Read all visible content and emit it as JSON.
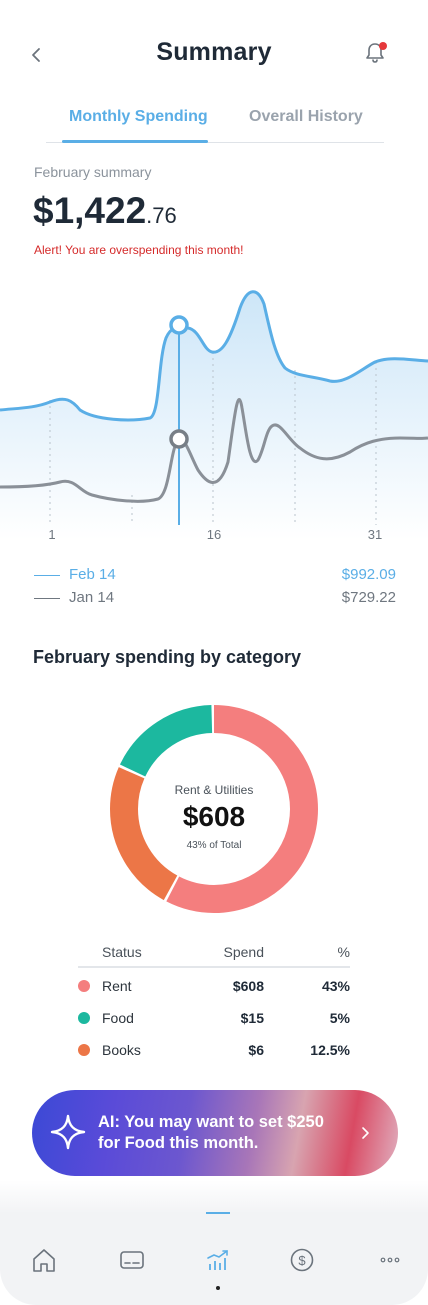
{
  "header": {
    "title": "Summary"
  },
  "tabs": [
    {
      "label": "Monthly Spending"
    },
    {
      "label": "Overall History"
    }
  ],
  "summary": {
    "label": "February summary",
    "total_main": "$1,422",
    "total_cents": ".76",
    "alert": "Alert! You are overspending this month!"
  },
  "chart_data": {
    "type": "area",
    "x_ticks": [
      "1",
      "16",
      "31"
    ],
    "series": [
      {
        "name": "Feb 14",
        "color": "#5aaee6"
      },
      {
        "name": "Jan 14",
        "color": "#8a9098"
      }
    ],
    "selected_x": "14"
  },
  "legend": [
    {
      "date": "Feb 14",
      "value": "$992.09",
      "color": "#5aaee6"
    },
    {
      "date": "Jan 14",
      "value": "$729.22",
      "color": "#6f7780"
    }
  ],
  "category_section": {
    "title": "February spending by category"
  },
  "donut": {
    "category": "Rent & Utilities",
    "amount": "$608",
    "percent_label": "43% of Total",
    "slices": [
      {
        "name": "Rent",
        "percent": 58,
        "color": "#f47e7e"
      },
      {
        "name": "Books",
        "percent": 24,
        "color": "#ec7647"
      },
      {
        "name": "Food",
        "percent": 18,
        "color": "#1cb89f"
      }
    ]
  },
  "table": {
    "headers": [
      "Status",
      "Spend",
      "%"
    ],
    "rows": [
      {
        "name": "Rent",
        "spend": "$608",
        "pct": "43%",
        "color": "#f47e7e"
      },
      {
        "name": "Food",
        "spend": "$15",
        "pct": "5%",
        "color": "#1cb89f"
      },
      {
        "name": "Books",
        "spend": "$6",
        "pct": "12.5%",
        "color": "#ec7647"
      }
    ]
  },
  "ai_banner": {
    "line1": "AI: You may want to set $250",
    "line2": "for Food this month."
  },
  "nav": [
    {
      "icon": "home-icon"
    },
    {
      "icon": "card-icon"
    },
    {
      "icon": "chart-icon",
      "active": true
    },
    {
      "icon": "dollar-icon"
    },
    {
      "icon": "more-icon"
    }
  ]
}
